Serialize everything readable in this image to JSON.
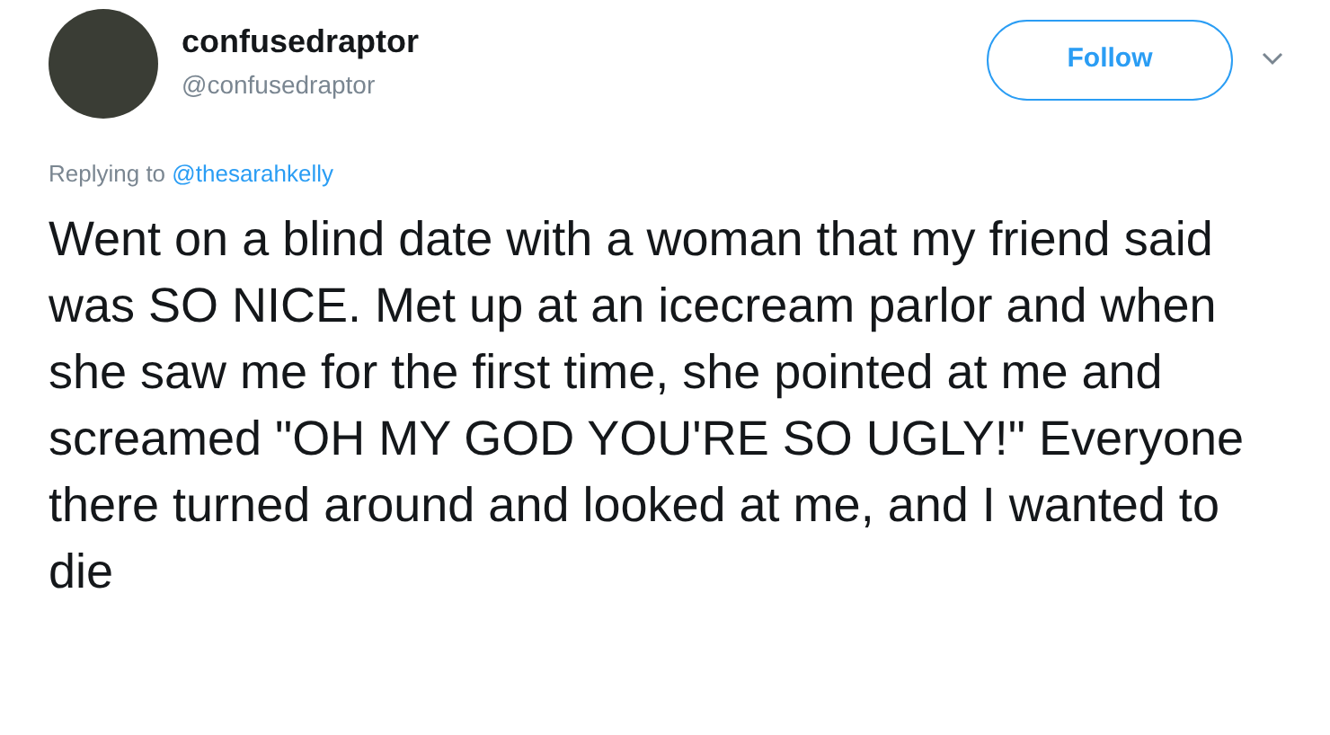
{
  "author": {
    "name": "confusedraptor",
    "handle": "@confusedraptor"
  },
  "follow_button": {
    "label": "Follow"
  },
  "reply_context": {
    "prefix": "Replying to",
    "mention": "@thesarahkelly"
  },
  "tweet_text": "Went on a blind date with a woman that my friend said was SO NICE. Met up at an icecream parlor and when she saw me for the first time, she pointed at me and screamed \"OH MY GOD YOU'RE SO UGLY!\" Everyone there turned around and looked at me, and I wanted to die"
}
